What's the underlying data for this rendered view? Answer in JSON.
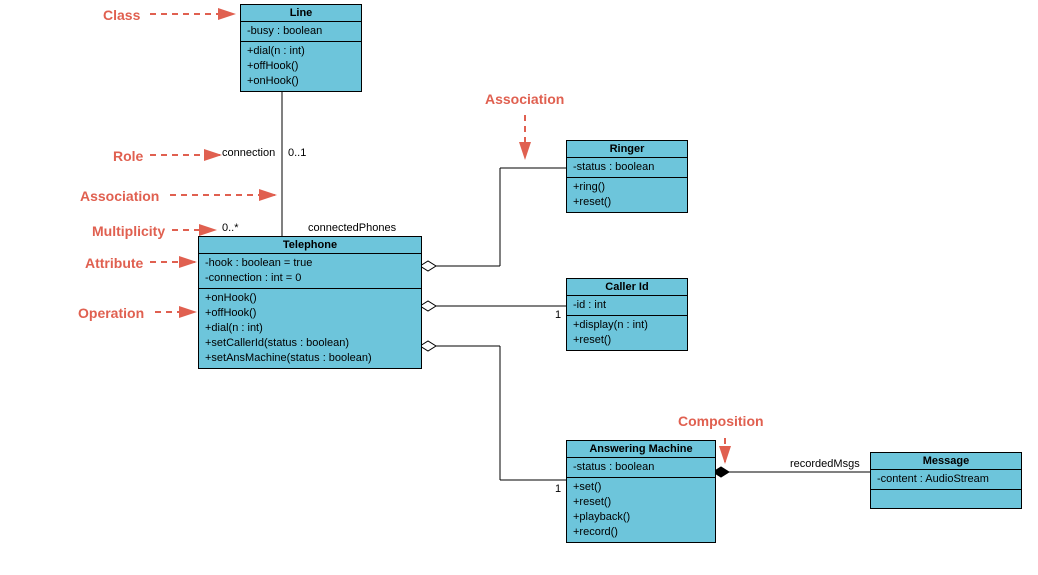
{
  "annotations": {
    "class": "Class",
    "role": "Role",
    "association1": "Association",
    "multiplicity": "Multiplicity",
    "attribute": "Attribute",
    "operation": "Operation",
    "association2": "Association",
    "composition": "Composition"
  },
  "classes": {
    "line": {
      "name": "Line",
      "attrs": [
        "-busy : boolean"
      ],
      "ops": [
        "+dial(n : int)",
        "+offHook()",
        "+onHook()"
      ]
    },
    "telephone": {
      "name": "Telephone",
      "attrs": [
        "-hook : boolean = true",
        "-connection : int = 0"
      ],
      "ops": [
        "+onHook()",
        "+offHook()",
        "+dial(n : int)",
        "+setCallerId(status : boolean)",
        "+setAnsMachine(status : boolean)"
      ]
    },
    "ringer": {
      "name": "Ringer",
      "attrs": [
        "-status : boolean"
      ],
      "ops": [
        "+ring()",
        "+reset()"
      ]
    },
    "callerId": {
      "name": "Caller Id",
      "attrs": [
        "-id : int"
      ],
      "ops": [
        "+display(n : int)",
        "+reset()"
      ]
    },
    "answeringMachine": {
      "name": "Answering Machine",
      "attrs": [
        "-status : boolean"
      ],
      "ops": [
        "+set()",
        "+reset()",
        "+playback()",
        "+record()"
      ]
    },
    "message": {
      "name": "Message",
      "attrs": [
        "-content : AudioStream"
      ]
    }
  },
  "labels": {
    "connection": "connection",
    "m01": "0..1",
    "m0star": "0..*",
    "connectedPhones": "connectedPhones",
    "one_caller": "1",
    "one_ans": "1",
    "recordedMsgs": "recordedMsgs"
  },
  "chart_data": {
    "type": "uml-class-diagram",
    "classes": [
      {
        "name": "Line",
        "attributes": [
          "-busy : boolean"
        ],
        "operations": [
          "+dial(n : int)",
          "+offHook()",
          "+onHook()"
        ]
      },
      {
        "name": "Telephone",
        "attributes": [
          "-hook : boolean = true",
          "-connection : int = 0"
        ],
        "operations": [
          "+onHook()",
          "+offHook()",
          "+dial(n : int)",
          "+setCallerId(status : boolean)",
          "+setAnsMachine(status : boolean)"
        ]
      },
      {
        "name": "Ringer",
        "attributes": [
          "-status : boolean"
        ],
        "operations": [
          "+ring()",
          "+reset()"
        ]
      },
      {
        "name": "Caller Id",
        "attributes": [
          "-id : int"
        ],
        "operations": [
          "+display(n : int)",
          "+reset()"
        ]
      },
      {
        "name": "Answering Machine",
        "attributes": [
          "-status : boolean"
        ],
        "operations": [
          "+set()",
          "+reset()",
          "+playback()",
          "+record()"
        ]
      },
      {
        "name": "Message",
        "attributes": [
          "-content : AudioStream"
        ],
        "operations": []
      }
    ],
    "relationships": [
      {
        "from": "Telephone",
        "to": "Line",
        "type": "association",
        "from_role": "connectedPhones",
        "from_mult": "0..*",
        "to_role": "connection",
        "to_mult": "0..1"
      },
      {
        "from": "Telephone",
        "to": "Ringer",
        "type": "aggregation"
      },
      {
        "from": "Telephone",
        "to": "Caller Id",
        "type": "aggregation",
        "to_mult": "1"
      },
      {
        "from": "Telephone",
        "to": "Answering Machine",
        "type": "aggregation",
        "to_mult": "1"
      },
      {
        "from": "Answering Machine",
        "to": "Message",
        "type": "composition",
        "to_role": "recordedMsgs"
      }
    ],
    "legend_annotations": [
      "Class",
      "Role",
      "Association",
      "Multiplicity",
      "Attribute",
      "Operation",
      "Composition"
    ]
  }
}
